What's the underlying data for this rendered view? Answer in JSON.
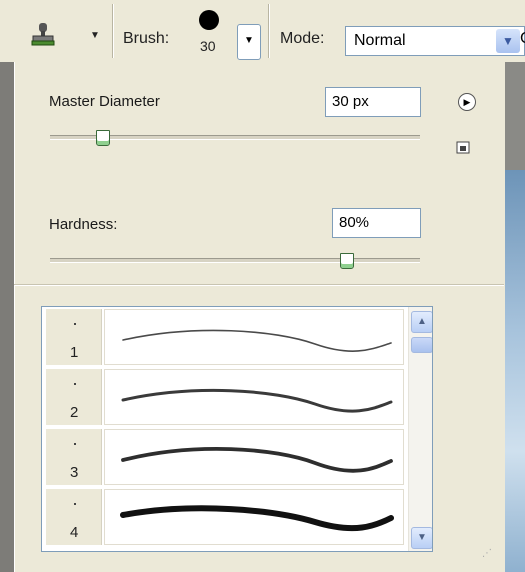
{
  "toolbar": {
    "tool_icon": "stamp-icon",
    "brush_label": "Brush:",
    "brush_size": "30",
    "mode_label": "Mode:",
    "mode_value": "Normal",
    "mode_extra": "C"
  },
  "panel": {
    "master_diameter_label": "Master Diameter",
    "master_diameter_value": "30 px",
    "master_diameter_level": 0.14,
    "hardness_label": "Hardness:",
    "hardness_value": "80%",
    "hardness_level": 0.8
  },
  "presets": [
    {
      "label": "1",
      "dot": "."
    },
    {
      "label": "2",
      "dot": "."
    },
    {
      "label": "3",
      "dot": "."
    },
    {
      "label": "4",
      "dot": "."
    }
  ],
  "icons": {
    "menu": "flyout-menu-arrow-icon",
    "new_preset": "new-preset-icon",
    "scroll_up": "scroll-up-arrow-icon",
    "scroll_down": "scroll-down-arrow-icon"
  },
  "colors": {
    "panel_bg": "#ece9d8",
    "field_border": "#7f9db9",
    "slider_thumb": "#8fd08f"
  }
}
